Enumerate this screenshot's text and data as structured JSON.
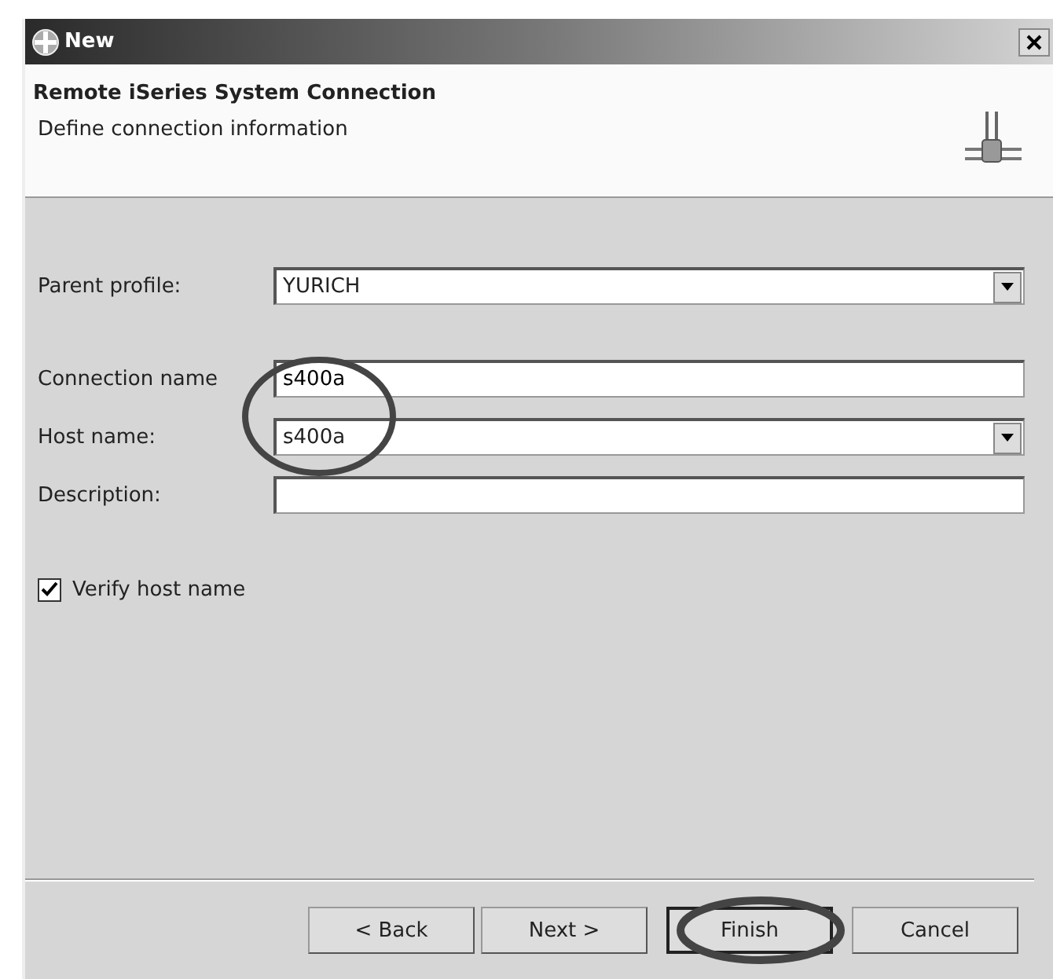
{
  "window": {
    "title": "New"
  },
  "header": {
    "title": "Remote iSeries System Connection",
    "description": "Define connection information"
  },
  "field_groups": [
    [
      {
        "kind": "combo",
        "label": "Parent profile:",
        "value": "YURICH"
      }
    ],
    [
      {
        "kind": "text",
        "label": "Connection name",
        "value": "s400a"
      },
      {
        "kind": "combo",
        "label": "Host name:",
        "value": "s400a"
      },
      {
        "kind": "text",
        "label": "Description:"
      }
    ]
  ],
  "verify": {
    "label": "Verify host name",
    "checked": true
  },
  "buttons": [
    {
      "label": "< Back",
      "default": false
    },
    {
      "label": "Next >",
      "default": false
    },
    {
      "label": "Finish",
      "default": true
    },
    {
      "label": "Cancel",
      "default": false
    }
  ]
}
